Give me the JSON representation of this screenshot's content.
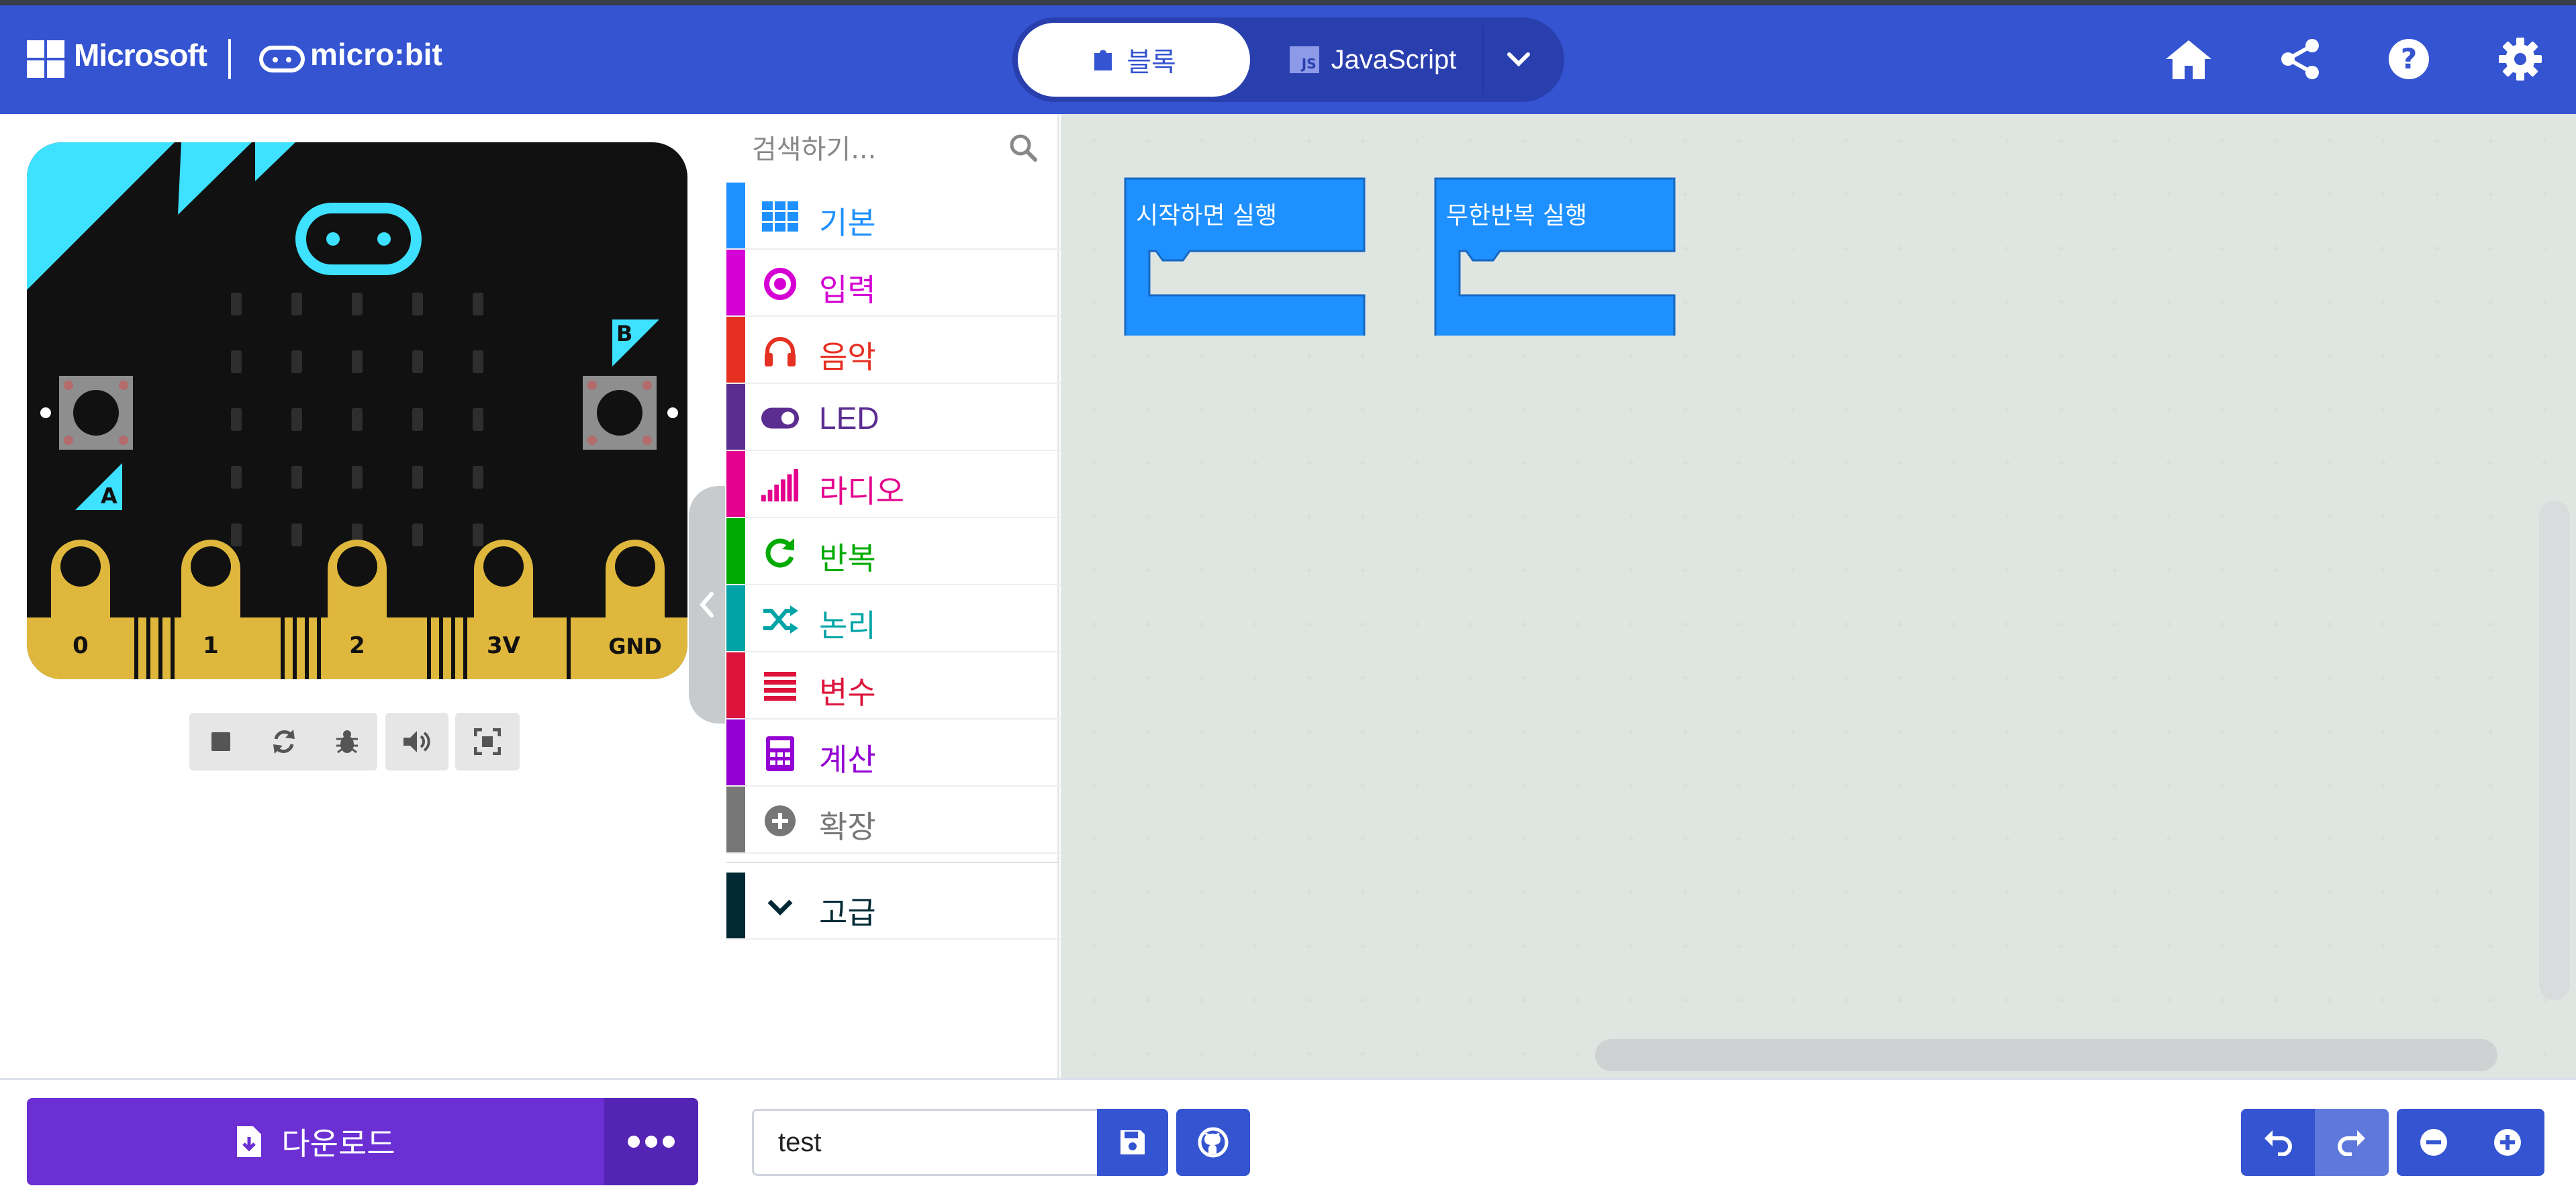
{
  "header": {
    "brand": "Microsoft",
    "product": "micro:bit",
    "modes": [
      {
        "label": "블록",
        "icon": "puzzle-icon",
        "active": true
      },
      {
        "label": "JavaScript",
        "icon": "js-icon",
        "badge": "JS",
        "active": false
      }
    ],
    "actions": [
      "home-icon",
      "share-icon",
      "help-icon",
      "settings-icon"
    ]
  },
  "simulator": {
    "pins": [
      "0",
      "1",
      "2",
      "3V",
      "GND"
    ],
    "button_a": "A",
    "button_b": "B",
    "controls": [
      "stop-icon",
      "restart-icon",
      "debug-icon",
      "sound-icon",
      "fullscreen-icon"
    ]
  },
  "toolbox": {
    "search_placeholder": "검색하기...",
    "categories": [
      {
        "label": "기본",
        "color": "#1e90ff",
        "icon": "grid-icon"
      },
      {
        "label": "입력",
        "color": "#d400d4",
        "icon": "target-icon"
      },
      {
        "label": "음악",
        "color": "#e63022",
        "icon": "headphones-icon"
      },
      {
        "label": "LED",
        "color": "#5c2d91",
        "icon": "toggle-icon"
      },
      {
        "label": "라디오",
        "color": "#e3008c",
        "icon": "signal-icon"
      },
      {
        "label": "반복",
        "color": "#00aa00",
        "icon": "refresh-icon"
      },
      {
        "label": "논리",
        "color": "#00a4a6",
        "icon": "shuffle-icon"
      },
      {
        "label": "변수",
        "color": "#dc143c",
        "icon": "list-icon"
      },
      {
        "label": "계산",
        "color": "#9400d3",
        "icon": "calculator-icon"
      },
      {
        "label": "확장",
        "color": "#777777",
        "icon": "plus-circle-icon"
      }
    ],
    "advanced": {
      "label": "고급",
      "color": "#002933",
      "icon": "chevron-down-icon"
    }
  },
  "workspace": {
    "blocks": [
      {
        "label": "시작하면 실행"
      },
      {
        "label": "무한반복 실행"
      }
    ],
    "block_color": "#1e90ff"
  },
  "bottom": {
    "download_label": "다운로드",
    "project_name": "test"
  }
}
